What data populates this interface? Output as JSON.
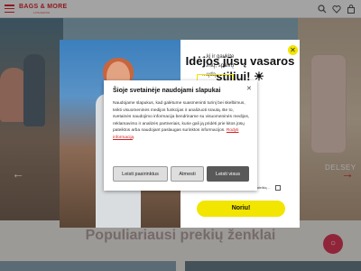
{
  "header": {
    "logo": "BAGS & MORE",
    "logo_sub": "LITHUANIA"
  },
  "hero": {
    "brand_text": "DELSEY",
    "prev_arrow": "arrow-left-icon",
    "next_arrow": "arrow-right-icon"
  },
  "section": {
    "title": "Populiariausi prekių ženklai"
  },
  "popup": {
    "title": "Idėjos jūsų vasaros stiliui! ☀",
    "desc": "...kį ir gaukite ...inių, spalvų ...ųdą.",
    "date_placeholder": "DD",
    "consent_text": "...pagal informacijos apie jus naudojimą, pateiktą ...",
    "submit_label": "Noriu!"
  },
  "cookie": {
    "title": "Šioje svetainėje naudojami slapukai",
    "body": "Naudojame slapukus, kad galėtume suasmeninti turinį bei skelbimus, teikti visuomeninės medijos funkcijas ir analizuoti srautą. Be to, svetainės naudojimo informacija bendriname su visuomeninės medijos, reklamavimo ir analizės partneriais, kurie gali ją pridėti prie kitos jūsų pateiktos arba naudojant paslaugas surinktos informacijos.",
    "link_text": "Rodyti informaciją",
    "settings_label": "Leisti pasirinktus",
    "reject_label": "Atmesti",
    "accept_label": "Leisti visus"
  }
}
